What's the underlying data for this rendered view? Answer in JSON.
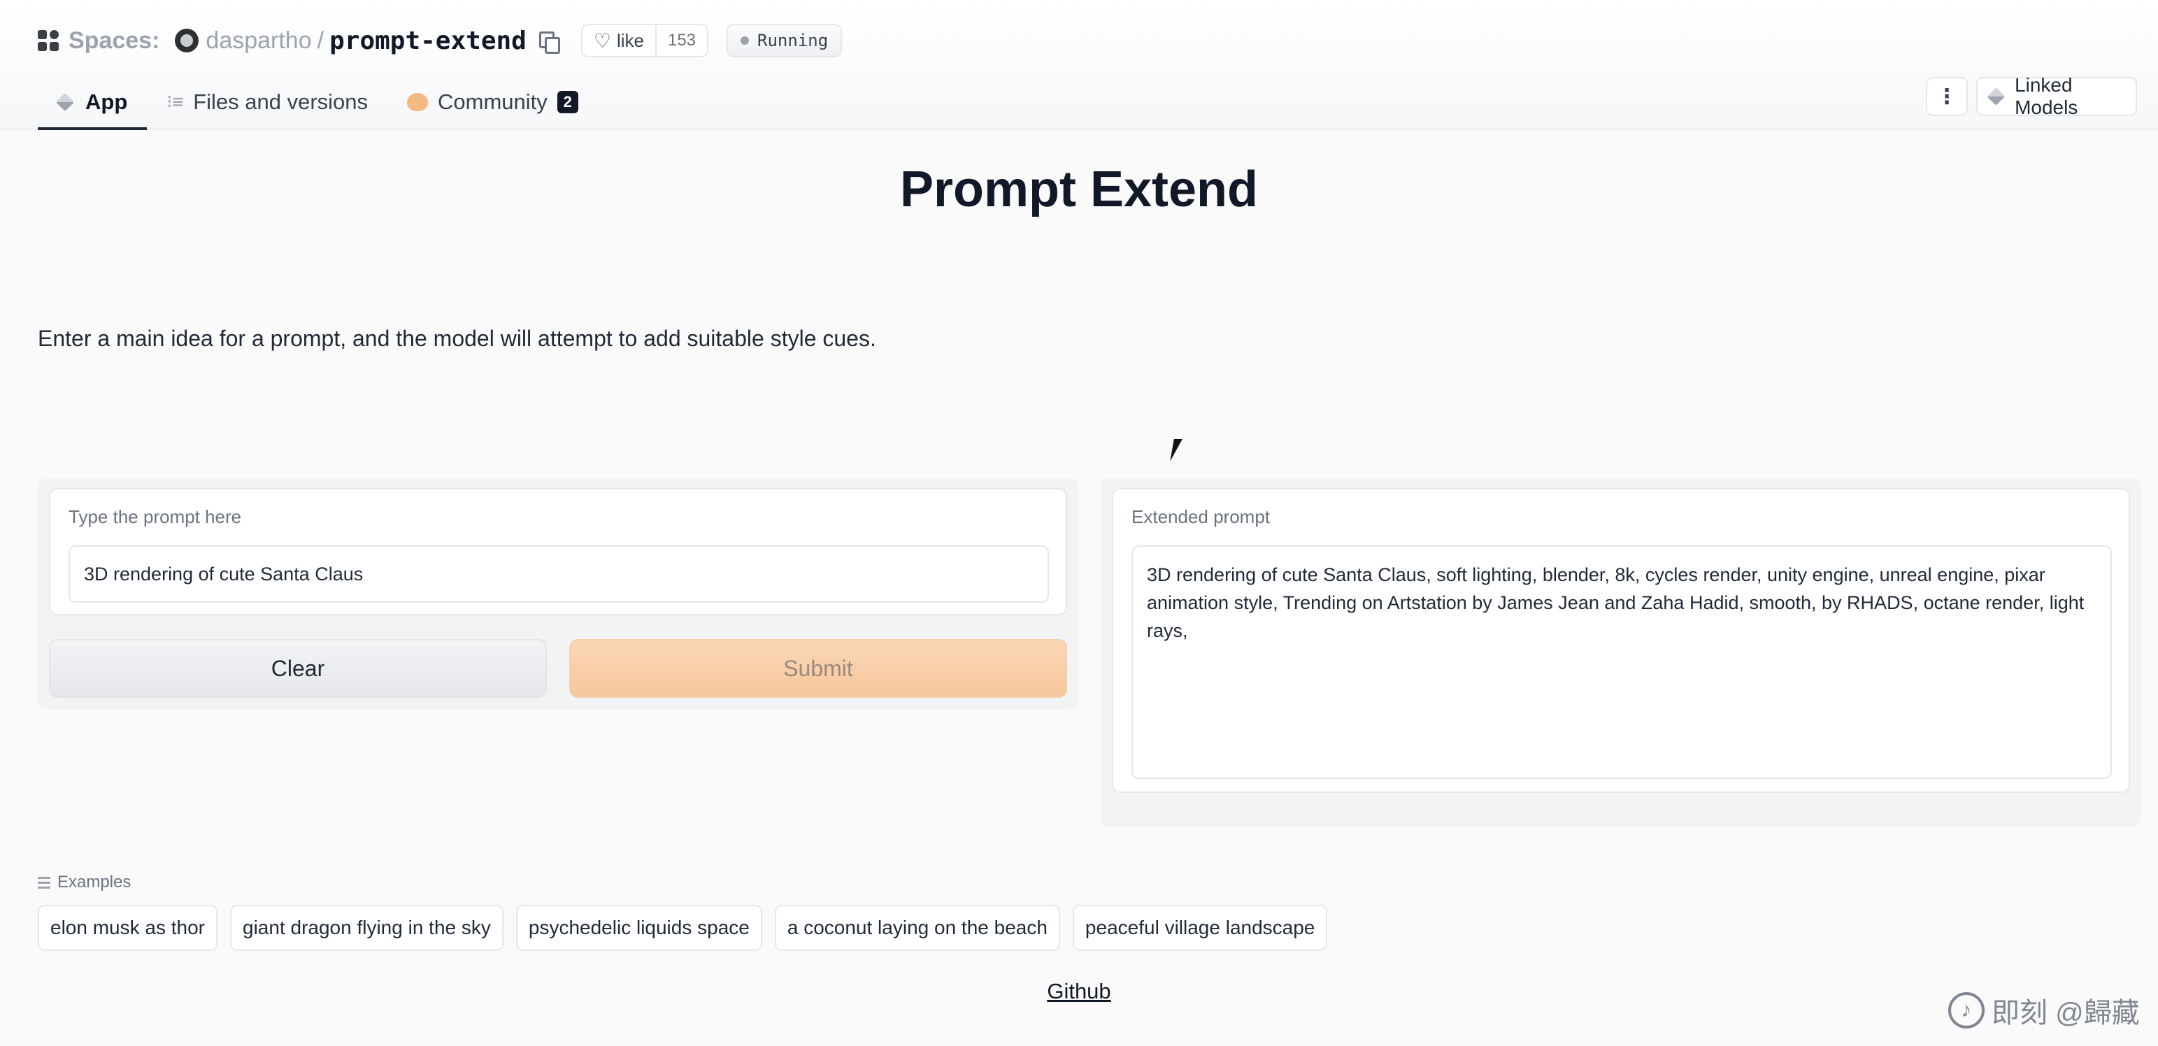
{
  "header": {
    "spaces_label": "Spaces:",
    "owner": "daspartho",
    "separator": "/",
    "repo": "prompt-extend",
    "like_label": "like",
    "like_count": "153",
    "status": "Running",
    "tabs": [
      {
        "label": "App",
        "icon": "cube-icon",
        "active": true
      },
      {
        "label": "Files and versions",
        "icon": "files-icon",
        "active": false
      },
      {
        "label": "Community",
        "icon": "community-icon",
        "active": false,
        "badge": "2"
      }
    ],
    "more_label": "⋮",
    "linked_models_label": "Linked Models"
  },
  "main": {
    "title": "Prompt Extend",
    "description": "Enter a main idea for a prompt, and the model will attempt to add suitable style cues.",
    "input": {
      "label": "Type the prompt here",
      "value": "3D rendering of cute Santa Claus"
    },
    "buttons": {
      "clear": "Clear",
      "submit": "Submit"
    },
    "output": {
      "label": "Extended prompt",
      "value": "3D rendering of cute Santa Claus, soft lighting, blender, 8k, cycles render, unity engine, unreal engine, pixar animation style, Trending on Artstation by James Jean and Zaha Hadid, smooth, by RHADS, octane render, light rays,"
    },
    "examples": {
      "label": "Examples",
      "items": [
        "elon musk as thor",
        "giant dragon flying in the sky",
        "psychedelic liquids space",
        "a coconut laying on the beach",
        "peaceful village landscape"
      ]
    },
    "footer_link": "Github"
  },
  "watermark": {
    "text": "即刻 @歸藏"
  },
  "colors": {
    "submit_bg": "#f7c69b",
    "clear_bg": "#e5e7eb",
    "title": "#111827"
  }
}
